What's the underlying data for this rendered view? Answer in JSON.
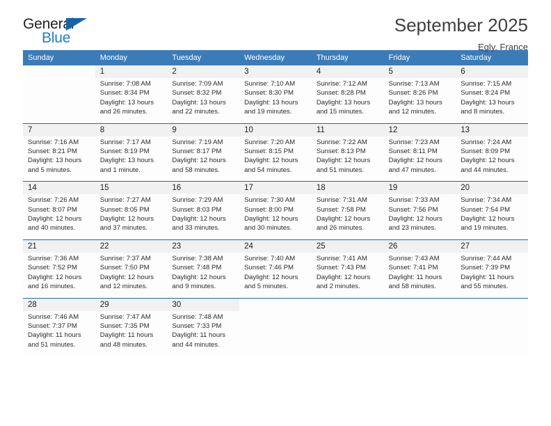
{
  "brand": {
    "name_part1": "General",
    "name_part2": "Blue",
    "triangle_color": "#1565a8",
    "blue_color": "#1c7fc4"
  },
  "header": {
    "title": "September 2025",
    "location": "Egly, France"
  },
  "theme": {
    "header_blue": "#3b7cb8",
    "rule_blue": "#1f6bb0",
    "daynum_band": "#f1f1f1"
  },
  "weekday_headers": [
    "Sunday",
    "Monday",
    "Tuesday",
    "Wednesday",
    "Thursday",
    "Friday",
    "Saturday"
  ],
  "weeks": [
    [
      {
        "day": "",
        "lines": []
      },
      {
        "day": "1",
        "lines": [
          "Sunrise: 7:08 AM",
          "Sunset: 8:34 PM",
          "Daylight: 13 hours",
          "and 26 minutes."
        ]
      },
      {
        "day": "2",
        "lines": [
          "Sunrise: 7:09 AM",
          "Sunset: 8:32 PM",
          "Daylight: 13 hours",
          "and 22 minutes."
        ]
      },
      {
        "day": "3",
        "lines": [
          "Sunrise: 7:10 AM",
          "Sunset: 8:30 PM",
          "Daylight: 13 hours",
          "and 19 minutes."
        ]
      },
      {
        "day": "4",
        "lines": [
          "Sunrise: 7:12 AM",
          "Sunset: 8:28 PM",
          "Daylight: 13 hours",
          "and 15 minutes."
        ]
      },
      {
        "day": "5",
        "lines": [
          "Sunrise: 7:13 AM",
          "Sunset: 8:26 PM",
          "Daylight: 13 hours",
          "and 12 minutes."
        ]
      },
      {
        "day": "6",
        "lines": [
          "Sunrise: 7:15 AM",
          "Sunset: 8:24 PM",
          "Daylight: 13 hours",
          "and 8 minutes."
        ]
      }
    ],
    [
      {
        "day": "7",
        "lines": [
          "Sunrise: 7:16 AM",
          "Sunset: 8:21 PM",
          "Daylight: 13 hours",
          "and 5 minutes."
        ]
      },
      {
        "day": "8",
        "lines": [
          "Sunrise: 7:17 AM",
          "Sunset: 8:19 PM",
          "Daylight: 13 hours",
          "and 1 minute."
        ]
      },
      {
        "day": "9",
        "lines": [
          "Sunrise: 7:19 AM",
          "Sunset: 8:17 PM",
          "Daylight: 12 hours",
          "and 58 minutes."
        ]
      },
      {
        "day": "10",
        "lines": [
          "Sunrise: 7:20 AM",
          "Sunset: 8:15 PM",
          "Daylight: 12 hours",
          "and 54 minutes."
        ]
      },
      {
        "day": "11",
        "lines": [
          "Sunrise: 7:22 AM",
          "Sunset: 8:13 PM",
          "Daylight: 12 hours",
          "and 51 minutes."
        ]
      },
      {
        "day": "12",
        "lines": [
          "Sunrise: 7:23 AM",
          "Sunset: 8:11 PM",
          "Daylight: 12 hours",
          "and 47 minutes."
        ]
      },
      {
        "day": "13",
        "lines": [
          "Sunrise: 7:24 AM",
          "Sunset: 8:09 PM",
          "Daylight: 12 hours",
          "and 44 minutes."
        ]
      }
    ],
    [
      {
        "day": "14",
        "lines": [
          "Sunrise: 7:26 AM",
          "Sunset: 8:07 PM",
          "Daylight: 12 hours",
          "and 40 minutes."
        ]
      },
      {
        "day": "15",
        "lines": [
          "Sunrise: 7:27 AM",
          "Sunset: 8:05 PM",
          "Daylight: 12 hours",
          "and 37 minutes."
        ]
      },
      {
        "day": "16",
        "lines": [
          "Sunrise: 7:29 AM",
          "Sunset: 8:03 PM",
          "Daylight: 12 hours",
          "and 33 minutes."
        ]
      },
      {
        "day": "17",
        "lines": [
          "Sunrise: 7:30 AM",
          "Sunset: 8:00 PM",
          "Daylight: 12 hours",
          "and 30 minutes."
        ]
      },
      {
        "day": "18",
        "lines": [
          "Sunrise: 7:31 AM",
          "Sunset: 7:58 PM",
          "Daylight: 12 hours",
          "and 26 minutes."
        ]
      },
      {
        "day": "19",
        "lines": [
          "Sunrise: 7:33 AM",
          "Sunset: 7:56 PM",
          "Daylight: 12 hours",
          "and 23 minutes."
        ]
      },
      {
        "day": "20",
        "lines": [
          "Sunrise: 7:34 AM",
          "Sunset: 7:54 PM",
          "Daylight: 12 hours",
          "and 19 minutes."
        ]
      }
    ],
    [
      {
        "day": "21",
        "lines": [
          "Sunrise: 7:36 AM",
          "Sunset: 7:52 PM",
          "Daylight: 12 hours",
          "and 16 minutes."
        ]
      },
      {
        "day": "22",
        "lines": [
          "Sunrise: 7:37 AM",
          "Sunset: 7:50 PM",
          "Daylight: 12 hours",
          "and 12 minutes."
        ]
      },
      {
        "day": "23",
        "lines": [
          "Sunrise: 7:38 AM",
          "Sunset: 7:48 PM",
          "Daylight: 12 hours",
          "and 9 minutes."
        ]
      },
      {
        "day": "24",
        "lines": [
          "Sunrise: 7:40 AM",
          "Sunset: 7:46 PM",
          "Daylight: 12 hours",
          "and 5 minutes."
        ]
      },
      {
        "day": "25",
        "lines": [
          "Sunrise: 7:41 AM",
          "Sunset: 7:43 PM",
          "Daylight: 12 hours",
          "and 2 minutes."
        ]
      },
      {
        "day": "26",
        "lines": [
          "Sunrise: 7:43 AM",
          "Sunset: 7:41 PM",
          "Daylight: 11 hours",
          "and 58 minutes."
        ]
      },
      {
        "day": "27",
        "lines": [
          "Sunrise: 7:44 AM",
          "Sunset: 7:39 PM",
          "Daylight: 11 hours",
          "and 55 minutes."
        ]
      }
    ],
    [
      {
        "day": "28",
        "lines": [
          "Sunrise: 7:46 AM",
          "Sunset: 7:37 PM",
          "Daylight: 11 hours",
          "and 51 minutes."
        ]
      },
      {
        "day": "29",
        "lines": [
          "Sunrise: 7:47 AM",
          "Sunset: 7:35 PM",
          "Daylight: 11 hours",
          "and 48 minutes."
        ]
      },
      {
        "day": "30",
        "lines": [
          "Sunrise: 7:48 AM",
          "Sunset: 7:33 PM",
          "Daylight: 11 hours",
          "and 44 minutes."
        ]
      },
      {
        "day": "",
        "lines": []
      },
      {
        "day": "",
        "lines": []
      },
      {
        "day": "",
        "lines": []
      },
      {
        "day": "",
        "lines": []
      }
    ]
  ]
}
